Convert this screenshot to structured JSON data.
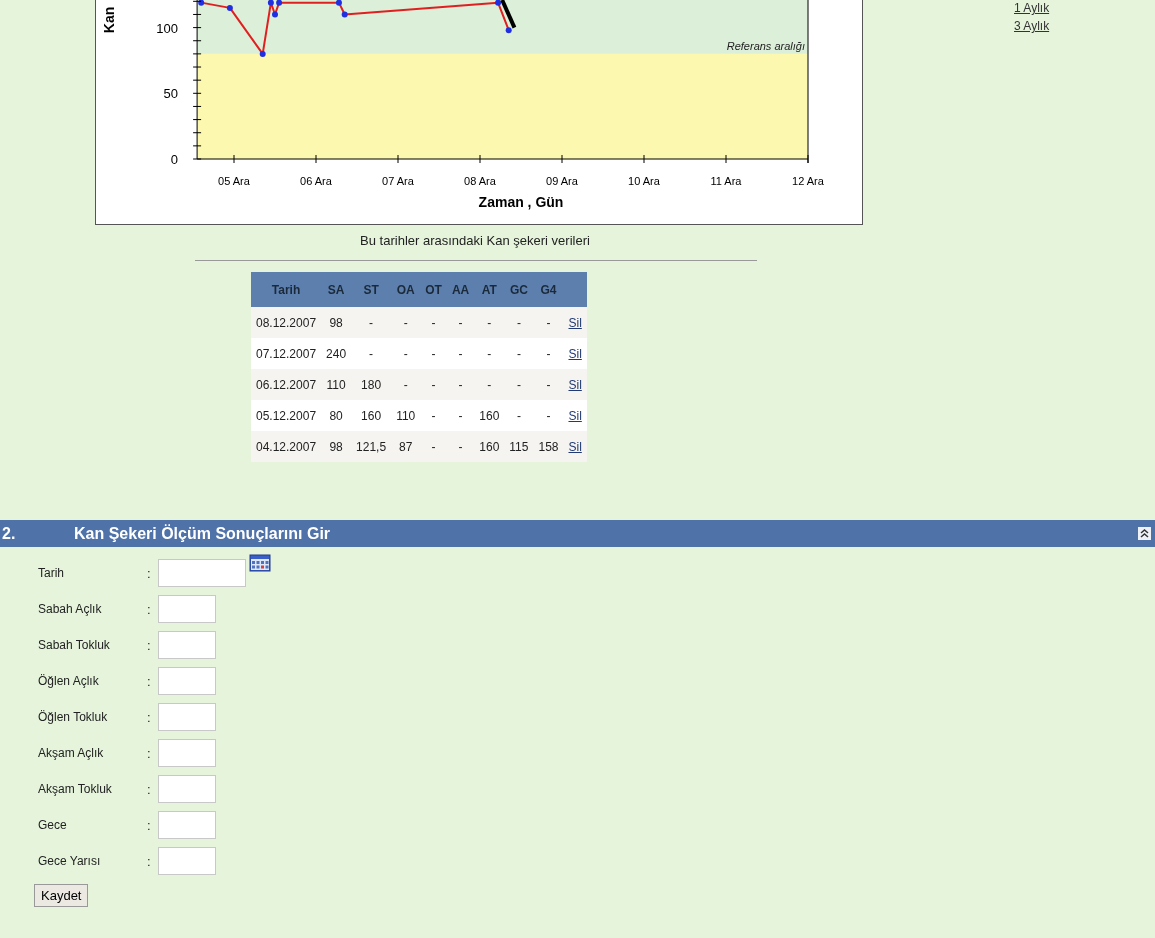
{
  "chart": {
    "chart_data": {
      "type": "line",
      "xlabel": "Zaman , Gün",
      "ylabel": "Kan",
      "xlim": [
        4.55,
        12
      ],
      "ylim": [
        0,
        121
      ],
      "xticks": [
        {
          "value": 5,
          "label": "05 Ara"
        },
        {
          "value": 6,
          "label": "06 Ara"
        },
        {
          "value": 7,
          "label": "07 Ara"
        },
        {
          "value": 8,
          "label": "08 Ara"
        },
        {
          "value": 9,
          "label": "09 Ara"
        },
        {
          "value": 10,
          "label": "10 Ara"
        },
        {
          "value": 11,
          "label": "11 Ara"
        },
        {
          "value": 12,
          "label": "12 Ara"
        }
      ],
      "yticks": [
        0,
        50,
        100
      ],
      "series": [
        {
          "color": "#e02020",
          "marker": "circle",
          "x": [
            4.6,
            4.95,
            5.35,
            5.45,
            5.5,
            5.55,
            6.28,
            6.35,
            8.22,
            8.35
          ],
          "values": [
            119,
            115,
            80,
            119,
            110,
            119,
            119,
            110,
            119,
            98
          ]
        },
        {
          "color": "#000000",
          "x": [
            8.27,
            8.42
          ],
          "values": [
            121,
            100
          ]
        }
      ],
      "bands": [
        {
          "axis": "y",
          "from": 80,
          "to": 121,
          "color": "#dcefd9",
          "label": "Referans aralığı"
        },
        {
          "axis": "y",
          "from": 0,
          "to": 80,
          "color": "#fdf8b0"
        }
      ]
    }
  },
  "period_links": [
    {
      "label": "1 Aylık"
    },
    {
      "label": "3 Aylık"
    }
  ],
  "table_caption": "Bu tarihler arasındaki Kan şekeri verileri",
  "table": {
    "columns": [
      "Tarih",
      "SA",
      "ST",
      "OA",
      "OT",
      "AA",
      "AT",
      "GC",
      "G4"
    ],
    "rows": [
      {
        "cells": [
          "08.12.2007",
          "98",
          "-",
          "-",
          "-",
          "-",
          "-",
          "-",
          "-"
        ],
        "action": "Sil"
      },
      {
        "cells": [
          "07.12.2007",
          "240",
          "-",
          "-",
          "-",
          "-",
          "-",
          "-",
          "-"
        ],
        "action": "Sil"
      },
      {
        "cells": [
          "06.12.2007",
          "110",
          "180",
          "-",
          "-",
          "-",
          "-",
          "-",
          "-"
        ],
        "action": "Sil"
      },
      {
        "cells": [
          "05.12.2007",
          "80",
          "160",
          "110",
          "-",
          "-",
          "160",
          "-",
          "-"
        ],
        "action": "Sil"
      },
      {
        "cells": [
          "04.12.2007",
          "98",
          "121,5",
          "87",
          "-",
          "-",
          "160",
          "115",
          "158"
        ],
        "action": "Sil"
      }
    ]
  },
  "section": {
    "number": "2.",
    "title": "Kan Şekeri Ölçüm Sonuçlarını Gir",
    "expanded": true
  },
  "form": {
    "fields": [
      {
        "label": "Tarih",
        "kind": "date"
      },
      {
        "label": "Sabah Açlık",
        "kind": "number"
      },
      {
        "label": "Sabah Tokluk",
        "kind": "number"
      },
      {
        "label": "Öğlen Açlık",
        "kind": "number"
      },
      {
        "label": "Öğlen Tokluk",
        "kind": "number"
      },
      {
        "label": "Akşam Açlık",
        "kind": "number"
      },
      {
        "label": "Akşam Tokluk",
        "kind": "number"
      },
      {
        "label": "Gece",
        "kind": "number"
      },
      {
        "label": "Gece Yarısı",
        "kind": "number"
      }
    ],
    "separator": ":",
    "submit": "Kaydet"
  }
}
